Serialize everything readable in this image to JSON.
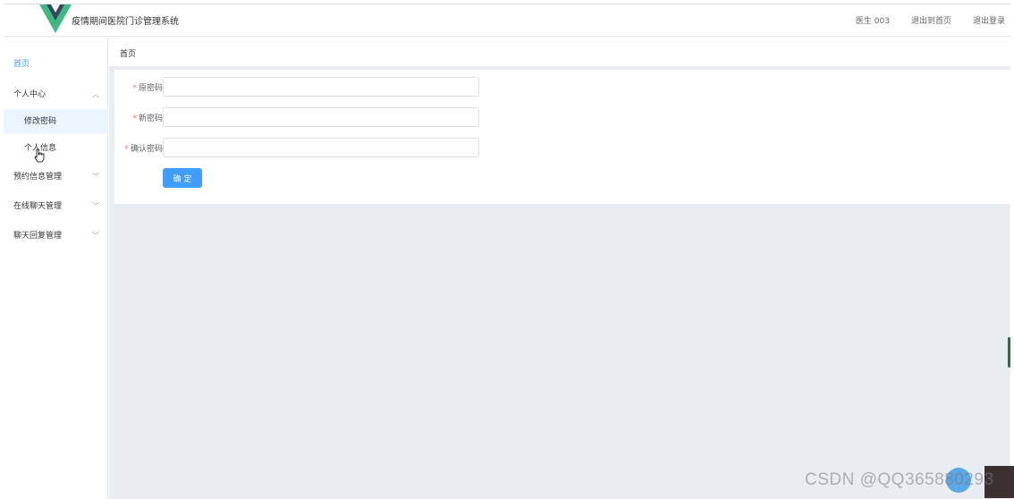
{
  "header": {
    "title": "疫情期间医院门诊管理系统",
    "user": "医生 003",
    "back_home": "退出到首页",
    "logout": "退出登录",
    "logo_colors": {
      "outer": "#41b883",
      "inner": "#35495e"
    }
  },
  "sidebar": {
    "home": "首页",
    "personal_center": "个人中心",
    "change_password": "修改密码",
    "personal_info": "个人信息",
    "appointment_mgmt": "预约信息管理",
    "online_chat_mgmt": "在线聊天管理",
    "chat_reply_mgmt": "聊天回复管理"
  },
  "breadcrumb": {
    "current": "首页"
  },
  "form": {
    "old_password_label": "原密码",
    "new_password_label": "新密码",
    "confirm_password_label": "确认密码",
    "required_mark": "*",
    "old_password_value": "",
    "new_password_value": "",
    "confirm_password_value": "",
    "submit_label": "确 定"
  },
  "watermark": "CSDN @QQ3658802​93",
  "colors": {
    "accent": "#409eff",
    "required": "#f56c6c",
    "main_bg": "#e9edf1"
  }
}
